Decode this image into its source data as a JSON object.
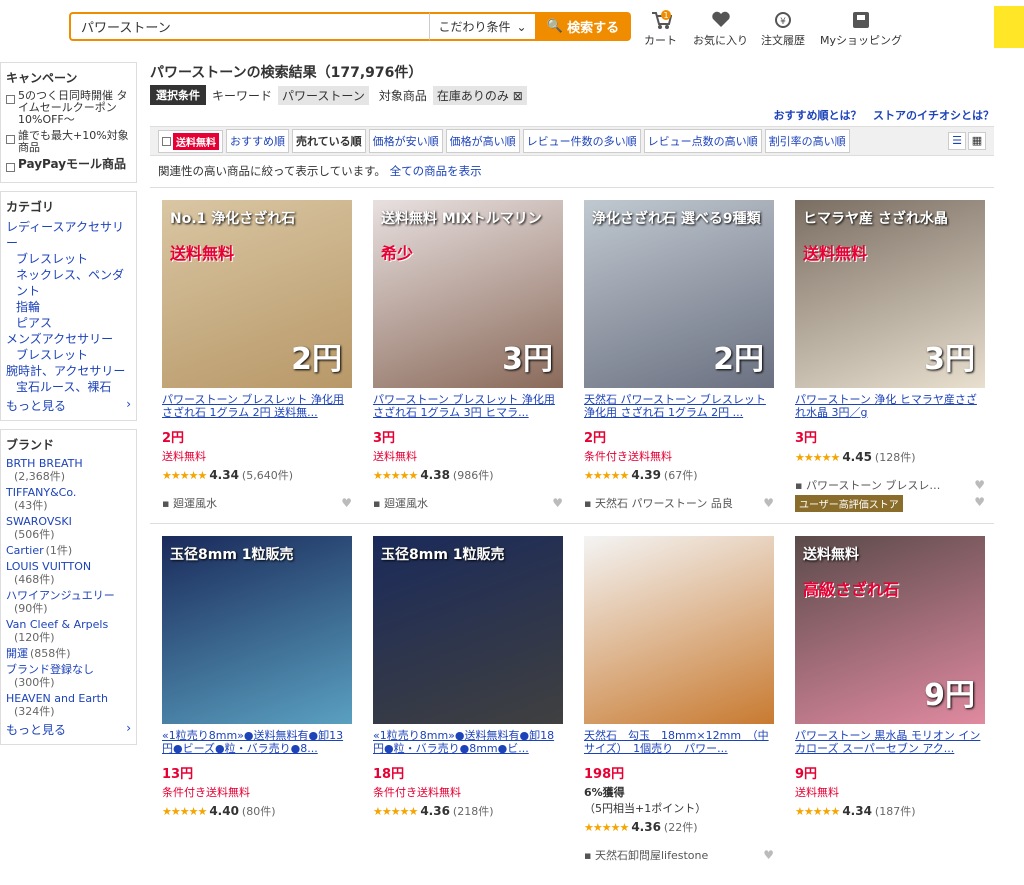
{
  "header": {
    "search_value": "パワーストーン",
    "condition": "こだわり条件",
    "search_button": "検索する",
    "cart": "カート",
    "cart_count": "1",
    "favorites": "お気に入り",
    "history": "注文履歴",
    "myshopping": "Myショッピング"
  },
  "sidebar": {
    "campaign_title": "キャンペーン",
    "campaign_items": [
      "5のつく日同時開催 タイムセールクーポン10%OFF〜",
      "誰でも最大+10%対象商品",
      "PayPayモール商品"
    ],
    "category_title": "カテゴリ",
    "categories": [
      "レディースアクセサリー",
      "ブレスレット",
      "ネックレス、ペンダント",
      "指輪",
      "ピアス",
      "メンズアクセサリー",
      "ブレスレット",
      "腕時計、アクセサリー",
      "宝石ルース、裸石"
    ],
    "more": "もっと見る",
    "brand_title": "ブランド",
    "brands": [
      {
        "name": "BRTH BREATH",
        "count": "(2,368件)"
      },
      {
        "name": "TIFFANY&Co.",
        "count": "(43件)"
      },
      {
        "name": "SWAROVSKI",
        "count": "(506件)"
      },
      {
        "name": "Cartier",
        "count": "(1件)"
      },
      {
        "name": "LOUIS VUITTON",
        "count": "(468件)"
      },
      {
        "name": "ハワイアンジュエリー",
        "count": "(90件)"
      },
      {
        "name": "Van Cleef & Arpels",
        "count": "(120件)"
      },
      {
        "name": "開運",
        "count": "(858件)"
      },
      {
        "name": "ブランド登録なし",
        "count": "(300件)"
      },
      {
        "name": "HEAVEN and Earth",
        "count": "(324件)"
      }
    ],
    "brand_more": "もっと見る"
  },
  "results": {
    "title": "パワーストーンの検索結果（177,976件）",
    "cond_label": "選択条件",
    "keyword_label": "キーワード",
    "keyword": "パワーストーン",
    "target_label": "対象商品",
    "target": "在庫ありのみ",
    "help1": "おすすめ順とは？",
    "help2": "ストアのイチオシとは？",
    "free_ship": "送料無料",
    "sorts": [
      "おすすめ順",
      "売れている順",
      "価格が安い順",
      "価格が高い順",
      "レビュー件数の多い順",
      "レビュー点数の高い順",
      "割引率の高い順"
    ],
    "note": "関連性の高い商品に絞って表示しています。",
    "note_link": "全ての商品を表示"
  },
  "products": [
    {
      "name": "パワーストーン ブレスレット 浄化用 さざれ石 1グラム 2円 送料無...",
      "price": "2円",
      "ship": "送料無料",
      "rating": "4.34",
      "count": "(5,640件)",
      "store": "廻運風水",
      "img": {
        "c1": "#d9c6a3",
        "c2": "#b89868",
        "t1": "No.1 浄化さざれ石",
        "t2": "送料無料",
        "t3": "2円"
      }
    },
    {
      "name": "パワーストーン ブレスレット 浄化用 さざれ石 1グラム 3円 ヒマラ...",
      "price": "3円",
      "ship": "送料無料",
      "rating": "4.38",
      "count": "(986件)",
      "store": "廻運風水",
      "img": {
        "c1": "#e8e0e0",
        "c2": "#8a6a5a",
        "t1": "送料無料 MIXトルマリン",
        "t2": "希少",
        "t3": "3円"
      }
    },
    {
      "name": "天然石 パワーストーン ブレスレット 浄化用 さざれ石 1グラム 2円 ...",
      "price": "2円",
      "ship": "条件付き送料無料",
      "rating": "4.39",
      "count": "(67件)",
      "store": "天然石 パワーストーン 品良",
      "img": {
        "c1": "#c0c8d0",
        "c2": "#6a7080",
        "t1": "浄化さざれ石 選べる9種類",
        "t2": "",
        "t3": "2円"
      }
    },
    {
      "name": "パワーストーン 浄化 ヒマラヤ産さざれ水晶 3円／g",
      "price": "3円",
      "ship": "",
      "rating": "4.45",
      "count": "(128件)",
      "store": "パワーストーン ブレスレ…",
      "badge": "ユーザー高評価ストア",
      "img": {
        "c1": "#7a6e62",
        "c2": "#e8dfcf",
        "t1": "ヒマラヤ産 さざれ水晶",
        "t2": "送料無料",
        "t3": "3円"
      }
    },
    {
      "name": "«1粒売り8mm»●送料無料有●卸13円●ビーズ●粒・バラ売り●8...",
      "price": "13円",
      "ship": "条件付き送料無料",
      "rating": "4.40",
      "count": "(80件)",
      "store": "",
      "img": {
        "c1": "#1a2a5a",
        "c2": "#5aa0c0",
        "t1": "玉径8mm 1粒販売",
        "t2": "",
        "t3": ""
      }
    },
    {
      "name": "«1粒売り8mm»●送料無料有●卸18円●粒・バラ売り●8mm●ビ...",
      "price": "18円",
      "ship": "条件付き送料無料",
      "rating": "4.36",
      "count": "(218件)",
      "store": "",
      "img": {
        "c1": "#1a2a5a",
        "c2": "#404040",
        "t1": "玉径8mm 1粒販売",
        "t2": "",
        "t3": ""
      }
    },
    {
      "name": "天然石　勾玉　18mm×12mm　（中サイズ）　1個売り　パワー...",
      "price": "198円",
      "earn": "6%獲得",
      "earn_detail": "（5円相当+1ポイント）",
      "rating": "4.36",
      "count": "(22件)",
      "store": "天然石卸問屋lifestone",
      "img": {
        "c1": "#f4f4f4",
        "c2": "#c87a30",
        "t1": "",
        "t2": "",
        "t3": ""
      }
    },
    {
      "name": "パワーストーン 黒水晶 モリオン インカローズ スーパーセブン アク...",
      "price": "9円",
      "ship": "送料無料",
      "rating": "4.34",
      "count": "(187件)",
      "store": "",
      "img": {
        "c1": "#5a4a4a",
        "c2": "#e08aa0",
        "t1": "送料無料",
        "t2": "高級さざれ石",
        "t3": "9円"
      }
    }
  ]
}
